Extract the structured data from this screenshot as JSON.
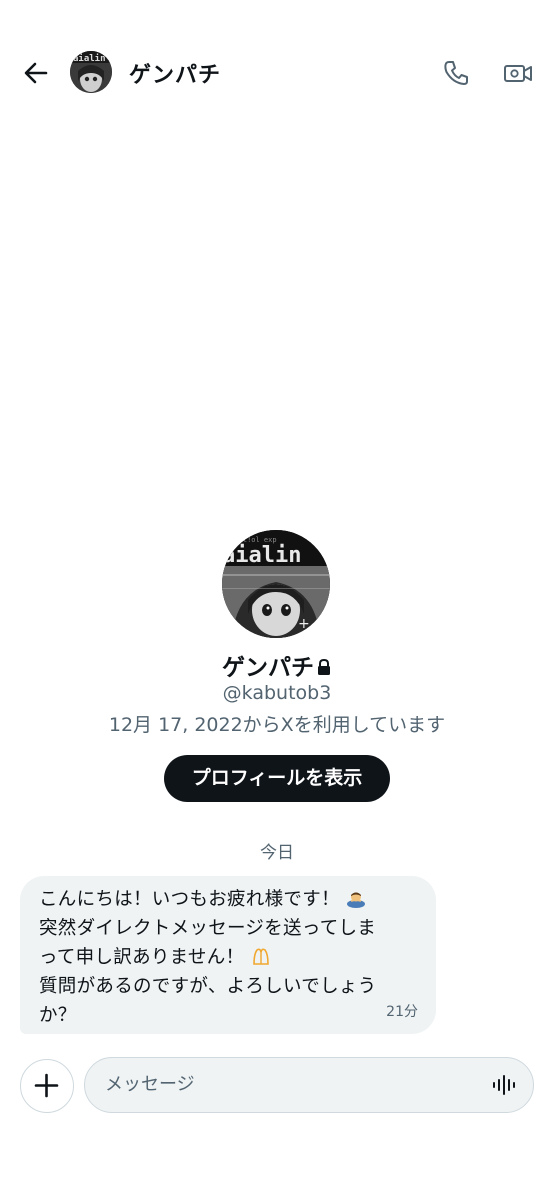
{
  "header": {
    "title": "ゲンパチ"
  },
  "profile": {
    "name": "ゲンパチ",
    "handle": "@kabutob3",
    "joined": "12月 17, 2022からXを利用しています",
    "button_label": "プロフィールを表示",
    "avatar_text": "aialin"
  },
  "conversation": {
    "date_divider": "今日",
    "messages": [
      {
        "line1": "こんにちは！いつもお疲れ様です！",
        "line2": "突然ダイレクトメッセージを送ってしま",
        "line3": "って申し訳ありません！",
        "line4": "質問があるのですが、よろしいでしょう",
        "line5": "か？",
        "time": "21分",
        "emoji1": "man-bowing-emoji",
        "emoji2": "hands-pressed-emoji"
      }
    ]
  },
  "composer": {
    "placeholder": "メッセージ"
  },
  "colors": {
    "primary_text": "#0f1419",
    "secondary_text": "#536471",
    "bubble_bg": "#eff3f4",
    "button_bg": "#0f1419"
  }
}
